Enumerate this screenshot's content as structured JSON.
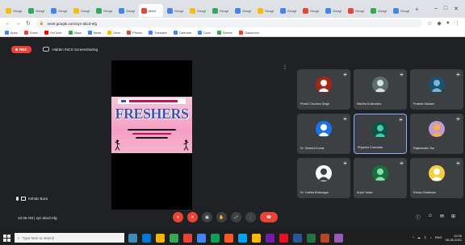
{
  "browser": {
    "tabs": [
      {
        "label": "Google",
        "color": "#fbbc04"
      },
      {
        "label": "Google",
        "color": "#34a853"
      },
      {
        "label": "Google",
        "color": "#4285f4"
      },
      {
        "label": "Google",
        "color": "#fbbc04"
      },
      {
        "label": "Google",
        "color": "#34a853"
      },
      {
        "label": "Google",
        "color": "#4285f4"
      },
      {
        "label": "Meet",
        "color": "#ea4335",
        "active": true
      },
      {
        "label": "Google",
        "color": "#4285f4"
      },
      {
        "label": "Google",
        "color": "#fbbc04"
      },
      {
        "label": "Google",
        "color": "#34a853"
      },
      {
        "label": "Google",
        "color": "#4285f4"
      },
      {
        "label": "Google",
        "color": "#fbbc04"
      },
      {
        "label": "Google",
        "color": "#4285f4"
      },
      {
        "label": "Google",
        "color": "#ea4335"
      },
      {
        "label": "Google",
        "color": "#4285f4"
      },
      {
        "label": "Google",
        "color": "#ea4335"
      },
      {
        "label": "Google",
        "color": "#34a853"
      },
      {
        "label": "Google",
        "color": "#4285f4"
      }
    ],
    "new_tab_glyph": "+",
    "window_controls": [
      "–",
      "□",
      "✕"
    ],
    "url": "meet.google.com/xyc-abcd-efg",
    "bookmarks": [
      {
        "label": "Apps",
        "color": "#4285f4"
      },
      {
        "label": "Gmail",
        "color": "#ea4335"
      },
      {
        "label": "YouTube",
        "color": "#ff0000"
      },
      {
        "label": "Maps",
        "color": "#34a853"
      },
      {
        "label": "News",
        "color": "#4285f4"
      },
      {
        "label": "Drive",
        "color": "#fbbc04"
      },
      {
        "label": "Photos",
        "color": "#ea4335"
      },
      {
        "label": "Translate",
        "color": "#4285f4"
      },
      {
        "label": "Calendar",
        "color": "#4285f4"
      },
      {
        "label": "Docs",
        "color": "#4285f4"
      },
      {
        "label": "Sheets",
        "color": "#34a853"
      },
      {
        "label": "Classroom",
        "color": "#ea4335"
      }
    ]
  },
  "meet": {
    "rec_label": "REC",
    "meeting_title": "Hidden INCS Screensharing",
    "presenter_label": "Kshitiz Bora",
    "more_glyph": "⋮",
    "poster": {
      "headline": "FRESHERS",
      "bg_colors": [
        "#f7c6d9",
        "#f59fc4"
      ]
    },
    "participants": [
      {
        "name": "Prachi Chouhan Singh",
        "avatar_bg": "#a52714",
        "avatar_fg": "#ffffff"
      },
      {
        "name": "Nishtha Kushwaha",
        "avatar_bg": "#5d6d6d",
        "avatar_fg": "#dbe0e0"
      },
      {
        "name": "Prateek Gautam",
        "avatar_bg": "#1a5276",
        "avatar_fg": "#7fb3d5"
      },
      {
        "name": "Dr. Sharma Kumar",
        "avatar_bg": "#1a73e8",
        "avatar_fg": "#ffffff"
      },
      {
        "name": "Priyanka Chaurasia",
        "avatar_bg": "#0b5345",
        "avatar_fg": "#48c9b0",
        "speaking": true
      },
      {
        "name": "Rajanandini Jha",
        "avatar_bg": "#c39bd3",
        "avatar_fg": "#f5b041"
      },
      {
        "name": "Dr. Yoshita Bhatnagar",
        "avatar_bg": "#ffffff",
        "avatar_fg": "#3c4043"
      },
      {
        "name": "Anjali Yadav",
        "avatar_bg": "#196f3d",
        "avatar_fg": "#82e0aa"
      },
      {
        "name": "Rohan Chatterjee",
        "avatar_bg": "#f4d03f",
        "avatar_fg": "#ffffff"
      }
    ],
    "clock": "10:36 AM  |  xyc-abcd-efg",
    "control_glyphs": [
      "✕",
      "✕",
      "▣",
      "✋",
      "⤢",
      "⋮",
      "☎"
    ],
    "right_glyphs": [
      "ⓘ",
      "☺",
      "✉",
      "⊞"
    ]
  },
  "taskbar": {
    "search_placeholder": "Type here to search",
    "apps": [
      "#3c8dbc",
      "#0078d7",
      "#f4b400",
      "#34a853",
      "#ea4335",
      "#4285f4",
      "#0f9d58",
      "#ff5722",
      "#00a4ef",
      "#ffb900",
      "#7719aa",
      "#e81123",
      "#2b579a",
      "#217346",
      "#b7472a",
      "#9b59b6"
    ],
    "tray_icons": [
      "^",
      "☁",
      "⏚",
      "♪",
      "ENG"
    ],
    "time": "10:36",
    "date": "28-08-2021"
  }
}
